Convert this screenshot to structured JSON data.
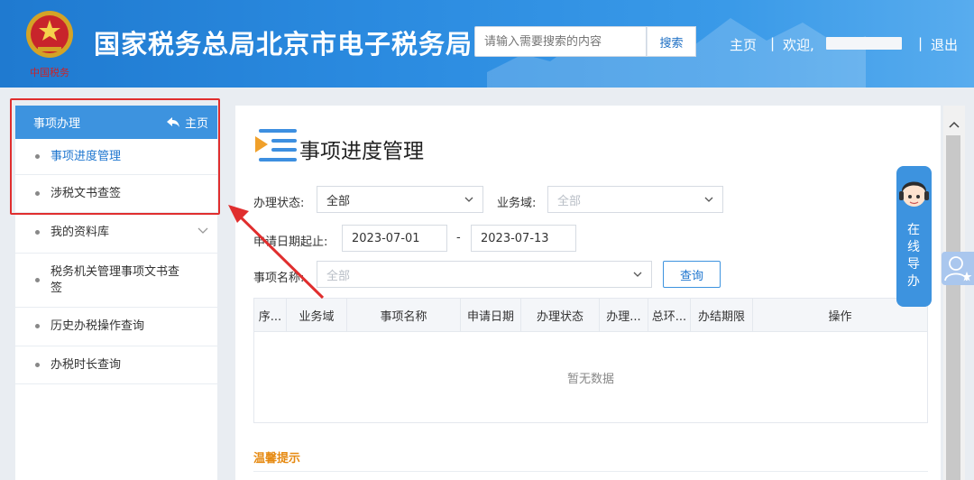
{
  "header": {
    "site_title": "国家税务总局北京市电子税务局",
    "search_placeholder": "请输入需要搜索的内容",
    "search_button": "搜索",
    "home_link": "主页",
    "sep1": "|",
    "welcome": "欢迎,",
    "sep2": "|",
    "logout": "退出",
    "emblem_caption": "中国税务"
  },
  "sidebar": {
    "section_title": "事项办理",
    "home_label": "主页",
    "items": [
      {
        "label": "事项进度管理",
        "active": true
      },
      {
        "label": "涉税文书查签"
      },
      {
        "label": "我的资料库",
        "has_submenu": true
      },
      {
        "label": "税务机关管理事项文书查签"
      },
      {
        "label": "历史办税操作查询"
      },
      {
        "label": "办税时长查询"
      }
    ]
  },
  "main": {
    "page_title": "事项进度管理",
    "filters": {
      "status_label": "办理状态:",
      "status_value": "全部",
      "domain_label": "业务域:",
      "domain_placeholder": "全部",
      "date_label": "申请日期起止:",
      "date_from": "2023-07-01",
      "date_sep": "-",
      "date_to": "2023-07-13",
      "name_label": "事项名称:",
      "name_placeholder": "全部",
      "query_button": "查询"
    },
    "table": {
      "columns": [
        "序...",
        "业务域",
        "事项名称",
        "申请日期",
        "办理状态",
        "办理...",
        "总环...",
        "办结期限",
        "操作"
      ],
      "empty_text": "暂无数据"
    },
    "tip_title": "温馨提示"
  },
  "widgets": {
    "online_guide": "在线导办"
  },
  "colors": {
    "header_blue": "#2b8be0",
    "accent": "#3d93df",
    "annotation_red": "#e02e2e",
    "tip_orange": "#e68a12"
  }
}
